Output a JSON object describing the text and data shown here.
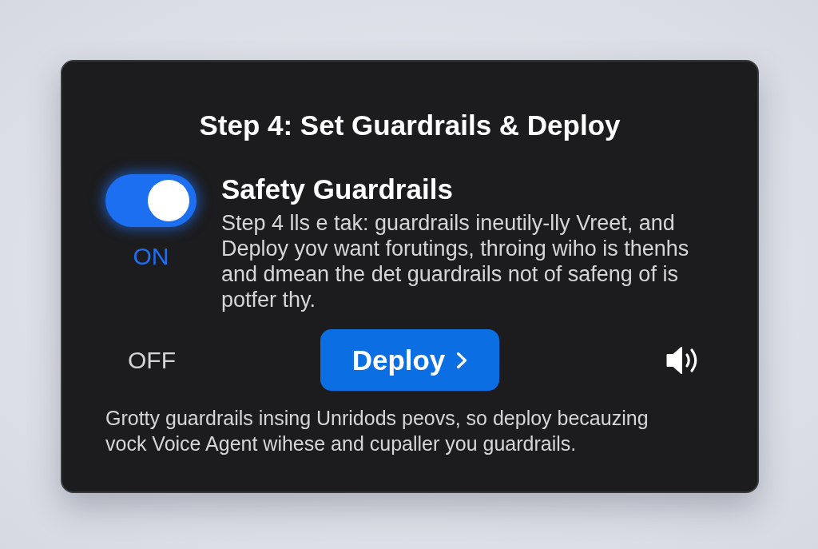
{
  "dialog": {
    "title": "Step 4: Set Guardrails & Deploy",
    "guardrails": {
      "on": true,
      "state_label": "ON",
      "heading": "Safety Guardrails",
      "description": "Step 4 lls e tak: guardrails ineutily-lly Vreet, and Deploy yov want forutings, throing wiho is thenhs and dmean the det guardrails not of safeng of is potfer thy."
    },
    "off_label": "OFF",
    "deploy_button": {
      "label": "Deploy"
    },
    "footer_text": "Grotty guardrails insing Unridods peovs, so deploy becauzing vock Voice Agent wihese and cupaller you guardrails."
  }
}
